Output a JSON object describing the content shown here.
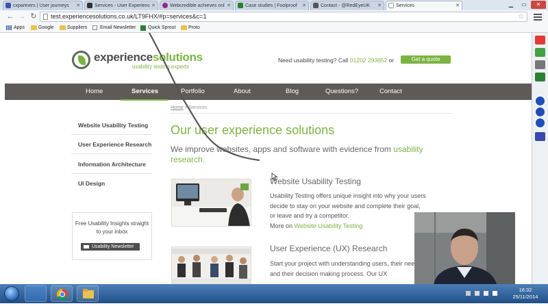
{
  "browser": {
    "tabs": [
      {
        "label": "cxpartners | User journeys",
        "fav_color": "#3f51b5"
      },
      {
        "label": "Services - User Experienc",
        "fav_color": "#333333"
      },
      {
        "label": "Webcredible achieves onl",
        "fav_color": "#8e2b8e"
      },
      {
        "label": "Case studies | Foolproof",
        "fav_color": "#2e7d32"
      },
      {
        "label": "Contact - @RedEyeUK",
        "fav_color": "#555555"
      },
      {
        "label": "Services",
        "fav_color": "#ffffff",
        "active": true
      }
    ],
    "url": "test.experiencesolutions.co.uk/LT9FHX/#p=services&c=1",
    "bookmarks": [
      {
        "label": "Apps",
        "icon": "apps-grid-icon"
      },
      {
        "label": "Google",
        "icon": "folder-icon"
      },
      {
        "label": "Suppliers",
        "icon": "folder-icon"
      },
      {
        "label": "Email Newsletter",
        "icon": "page-icon"
      },
      {
        "label": "Quick Sprout",
        "icon": "qs-icon"
      },
      {
        "label": "Proto",
        "icon": "folder-icon"
      }
    ]
  },
  "site": {
    "logo": {
      "word_a": "experience",
      "word_b": "solutions",
      "tagline": "usability testing experts"
    },
    "contact": {
      "prefix": "Need usability testing?  Call ",
      "phone": "01202 293652",
      "or": " or "
    },
    "quote_button": "Get a quote",
    "nav": [
      "Home",
      "Services",
      "Portfolio",
      "About",
      "Blog",
      "Questions?",
      "Contact"
    ],
    "active_nav": "Services",
    "sidebar": [
      "Website Usability Testing",
      "User Experience Research",
      "Information Architecture",
      "UI Design"
    ],
    "insights": {
      "text": "Free Usability Insights straight to your inbox",
      "button": "Usability Newsletter"
    },
    "breadcrumb": {
      "home": "Home",
      "sep": " > ",
      "current": "Services"
    },
    "heading": "Our user experience solutions",
    "intro": {
      "text": "We improve websites, apps and software with evidence from ",
      "link": "usability research."
    },
    "sections": [
      {
        "title": "Website Usability Testing",
        "text": "Usability Testing offers unique insight into why your users decide to stay on your website and complete their goal, or leave and try a competitor.",
        "more_prefix": "More on ",
        "more_link": "Website Usability Testing"
      },
      {
        "title": "User Experience (UX) Research",
        "text": "Start your project with understanding users, their needs, and their decision making process. Our UX"
      }
    ]
  },
  "taskbar": {
    "time": "16:32",
    "date": "25/11/2014"
  },
  "colors": {
    "brand_green": "#7cb342",
    "nav_bg": "#5e5a57"
  }
}
